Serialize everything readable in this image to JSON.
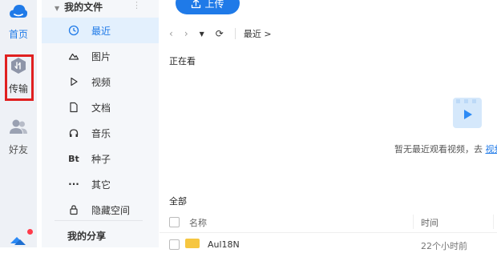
{
  "rail": {
    "home_label": "首页",
    "transfer_label": "传输",
    "friends_label": "好友"
  },
  "nav": {
    "header": "我的文件",
    "items": [
      {
        "label": "最近",
        "icon": "clock-icon"
      },
      {
        "label": "图片",
        "icon": "image-icon"
      },
      {
        "label": "视频",
        "icon": "play-icon"
      },
      {
        "label": "文档",
        "icon": "document-icon"
      },
      {
        "label": "音乐",
        "icon": "headphones-icon"
      },
      {
        "label": "种子",
        "icon": "bt-icon",
        "glyph": "Bt"
      },
      {
        "label": "其它",
        "icon": "more-icon",
        "glyph": "···"
      },
      {
        "label": "隐藏空间",
        "icon": "lock-icon"
      }
    ],
    "share_header": "我的分享"
  },
  "main": {
    "upload_label": "上传",
    "breadcrumb": "最近 >",
    "section_recent": "正在看",
    "empty_text": "暂无最近观看视频，去 ",
    "empty_link": "视频",
    "section_all": "全部",
    "table": {
      "col_name": "名称",
      "col_time": "时间",
      "rows": [
        {
          "name": "Aul18N",
          "time": "22个小时前"
        }
      ]
    }
  },
  "colors": {
    "accent": "#1f7ae8",
    "highlight": "#e02020",
    "folder": "#f6c640"
  }
}
